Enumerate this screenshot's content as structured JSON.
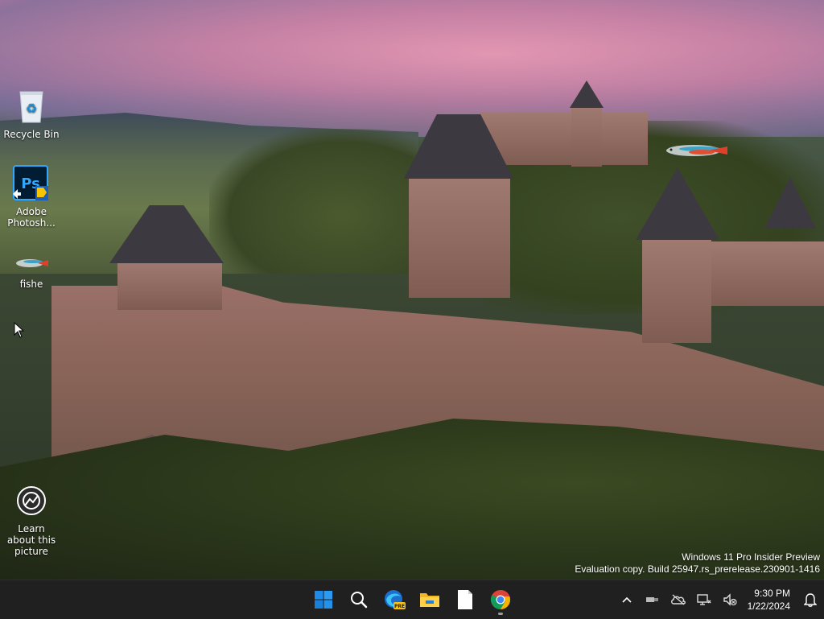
{
  "desktop": {
    "icons": [
      {
        "name": "recycle-bin",
        "label": "Recycle Bin"
      },
      {
        "name": "adobe-photoshop",
        "label": "Adobe Photosh..."
      },
      {
        "name": "fishe",
        "label": "fishe"
      },
      {
        "name": "learn-about-picture",
        "label": "Learn about this picture"
      }
    ],
    "watermark": {
      "line1": "Windows 11 Pro Insider Preview",
      "line2": "Evaluation copy. Build 25947.rs_prerelease.230901-1416"
    }
  },
  "taskbar": {
    "apps": [
      {
        "name": "start-button",
        "icon": "windows-logo-icon"
      },
      {
        "name": "search-button",
        "icon": "search-icon"
      },
      {
        "name": "edge-preview-button",
        "icon": "edge-pre-icon",
        "badge": "PRE"
      },
      {
        "name": "file-explorer-button",
        "icon": "folder-icon"
      },
      {
        "name": "notepad-button",
        "icon": "document-icon"
      },
      {
        "name": "chrome-button",
        "icon": "chrome-icon",
        "running": true
      }
    ],
    "tray": {
      "clock_time": "9:30 PM",
      "clock_date": "1/22/2024"
    }
  },
  "colors": {
    "taskbar_bg": "#202020",
    "accent_blue": "#1f8ae8"
  }
}
